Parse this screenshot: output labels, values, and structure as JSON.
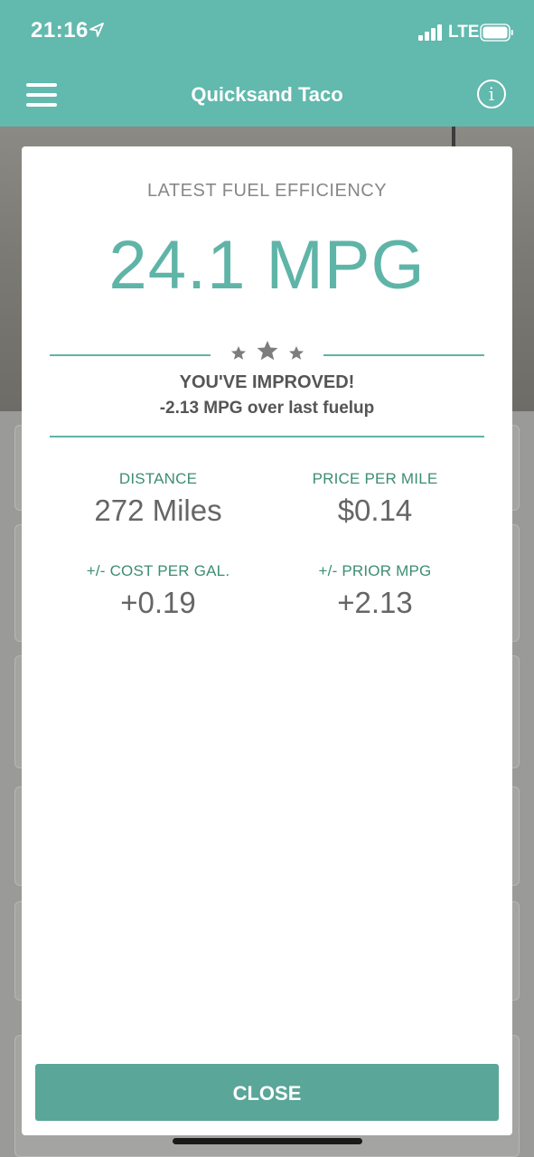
{
  "status_bar": {
    "time": "21:16",
    "network": "LTE",
    "location_icon": "location-arrow-icon",
    "signal_icon": "cellular-signal-icon",
    "battery_icon": "battery-icon"
  },
  "nav": {
    "title": "Quicksand Taco",
    "menu_icon": "hamburger-menu-icon",
    "info_icon": "info-icon",
    "info_glyph": "i"
  },
  "modal": {
    "heading": "LATEST FUEL EFFICIENCY",
    "mpg": "24.1 MPG",
    "stars_icon": "three-stars-icon",
    "improved_title": "YOU'VE IMPROVED!",
    "improved_subtitle": "-2.13 MPG over last fuelup",
    "stats": [
      {
        "label": "DISTANCE",
        "value": "272 Miles"
      },
      {
        "label": "PRICE PER MILE",
        "value": "$0.14"
      },
      {
        "label": "+/- COST PER GAL.",
        "value": "+0.19"
      },
      {
        "label": "+/- PRIOR MPG",
        "value": "+2.13"
      }
    ],
    "close_label": "CLOSE"
  },
  "colors": {
    "brand_teal": "#62b9ae",
    "mpg_teal": "#5fb4a8",
    "stat_label_green": "#3d8d73",
    "close_button": "#5aa698"
  }
}
